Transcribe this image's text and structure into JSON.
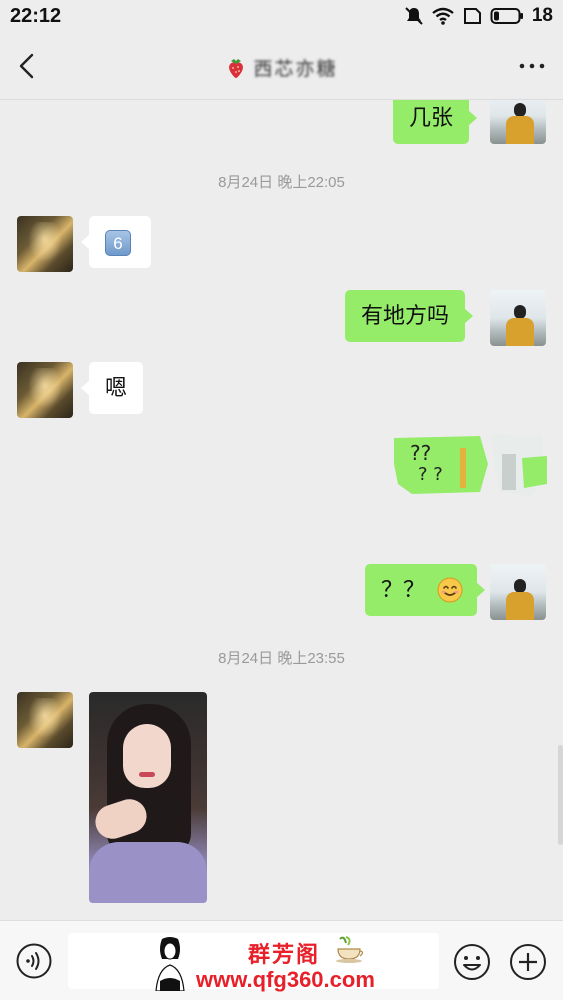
{
  "status_bar": {
    "time": "22:12",
    "battery": "18",
    "icons": [
      "mute-icon",
      "wifi-icon",
      "sim-icon",
      "battery-icon"
    ]
  },
  "nav": {
    "title": "西芯亦糖",
    "back_icon": "chevron-left-icon",
    "more_icon": "more-dots-icon"
  },
  "messages": [
    {
      "side": "me",
      "text": "几张"
    },
    {
      "type": "timestamp",
      "text": "8月24日 晚上22:05"
    },
    {
      "side": "other",
      "text": "6"
    },
    {
      "side": "me",
      "text": "有地方吗"
    },
    {
      "side": "other",
      "text": "嗯"
    },
    {
      "side": "me",
      "type": "sticker",
      "text": "??"
    },
    {
      "side": "me",
      "text": "？？"
    },
    {
      "type": "timestamp",
      "text": "8月24日 晚上23:55"
    },
    {
      "side": "other",
      "type": "photo"
    }
  ],
  "input_bar": {
    "voice_icon": "voice-icon",
    "emoji_icon": "emoji-icon",
    "plus_icon": "plus-icon",
    "watermark_site": "www.qfg360.com",
    "watermark_name": "群芳阁"
  },
  "colors": {
    "bubble_me": "#95ec69",
    "bubble_other": "#ffffff",
    "background": "#ededed",
    "timestamp": "#9a9a9a",
    "watermark": "#e8202a"
  }
}
